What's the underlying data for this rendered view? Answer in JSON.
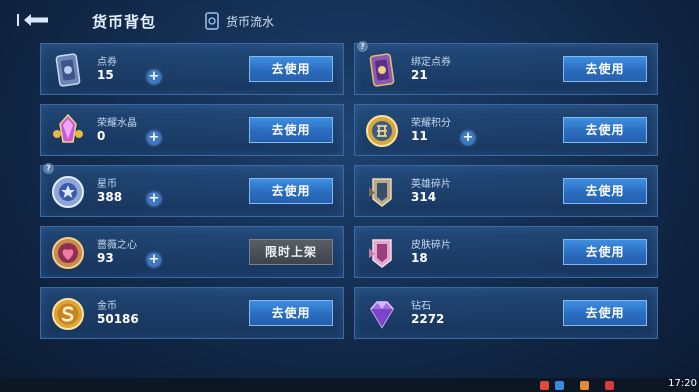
{
  "header": {
    "tab_backpack": "货币背包",
    "tab_flow": "货币流水"
  },
  "currencies": [
    {
      "name": "点券",
      "amount": "15",
      "button": "去使用"
    },
    {
      "name": "绑定点券",
      "amount": "21",
      "button": "去使用"
    },
    {
      "name": "荣耀水晶",
      "amount": "0",
      "button": "去使用"
    },
    {
      "name": "荣耀积分",
      "amount": "11",
      "button": "去使用"
    },
    {
      "name": "星币",
      "amount": "388",
      "button": "去使用"
    },
    {
      "name": "英雄碎片",
      "amount": "314",
      "button": "去使用"
    },
    {
      "name": "蔷薇之心",
      "amount": "93",
      "button": "限时上架"
    },
    {
      "name": "皮肤碎片",
      "amount": "18",
      "button": "去使用"
    },
    {
      "name": "金币",
      "amount": "50186",
      "button": "去使用"
    },
    {
      "name": "钻石",
      "amount": "2272",
      "button": "去使用"
    }
  ],
  "help_mark": "?",
  "plus_symbol": "+",
  "taskbar": {
    "clock": "17:20"
  }
}
